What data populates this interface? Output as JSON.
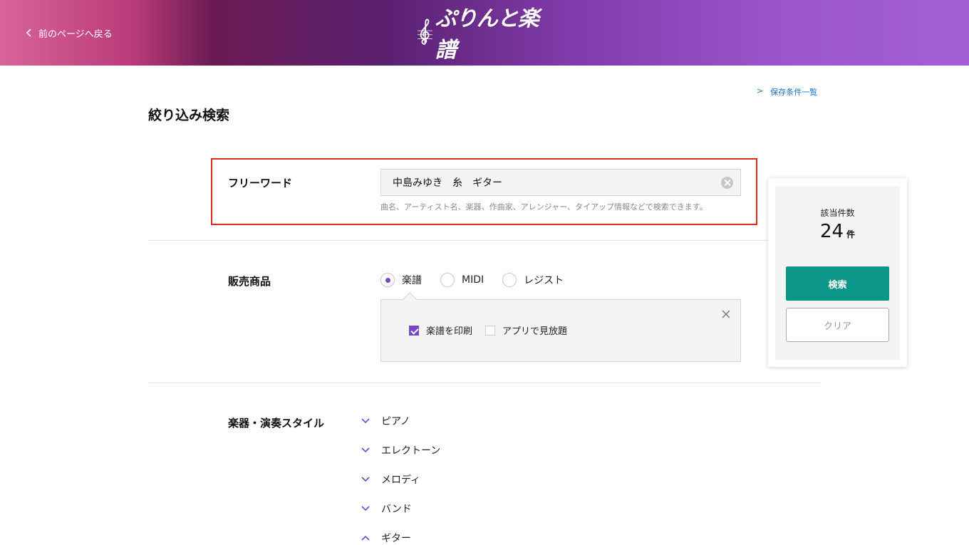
{
  "header": {
    "back_label": "前のページへ戻る",
    "logo_text": "ぷりんと楽譜"
  },
  "saved_conditions": {
    "arrow": ">",
    "label": "保存条件一覧"
  },
  "page_title": "絞り込み検索",
  "freeword": {
    "label": "フリーワード",
    "value": "中島みゆき　糸　ギター",
    "hint": "曲名、アーティスト名、楽器、作曲家、アレンジャー、タイアップ情報などで検索できます。"
  },
  "product": {
    "label": "販売商品",
    "options": [
      {
        "label": "楽譜",
        "selected": true
      },
      {
        "label": "MIDI",
        "selected": false
      },
      {
        "label": "レジスト",
        "selected": false
      }
    ],
    "sub_options": [
      {
        "label": "楽譜を印刷",
        "checked": true
      },
      {
        "label": "アプリで見放題",
        "checked": false
      }
    ]
  },
  "instruments": {
    "label": "楽器・演奏スタイル",
    "items": [
      {
        "label": "ピアノ",
        "expanded": false
      },
      {
        "label": "エレクトーン",
        "expanded": false
      },
      {
        "label": "メロディ",
        "expanded": false
      },
      {
        "label": "バンド",
        "expanded": false
      },
      {
        "label": "ギター",
        "expanded": true
      }
    ]
  },
  "results": {
    "label": "該当件数",
    "count": "24",
    "unit": "件",
    "search_label": "検索",
    "clear_label": "クリア"
  },
  "colors": {
    "accent_purple": "#7b45c9",
    "search_button": "#0c9688",
    "highlight_border": "#e02b1f",
    "link_blue": "#1a73c8"
  }
}
